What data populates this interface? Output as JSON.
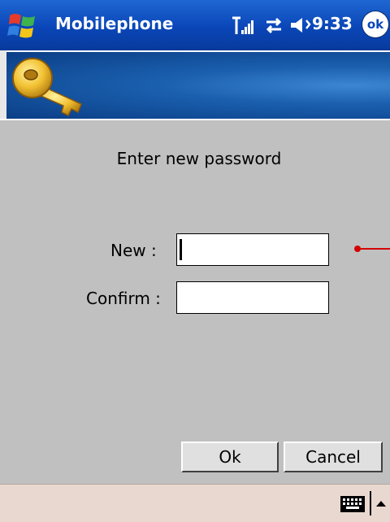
{
  "titlebar": {
    "title": "Mobilephone",
    "clock": "9:33",
    "ok_label": "ok"
  },
  "content": {
    "prompt": "Enter new password",
    "new_label": "New :",
    "confirm_label": "Confirm :",
    "new_value": "",
    "confirm_value": ""
  },
  "buttons": {
    "ok": "Ok",
    "cancel": "Cancel"
  },
  "colors": {
    "titlebar": "#0a46b8",
    "body": "#c0c0c0",
    "banner": "#1a5fae",
    "bottombar": "#e8d8d0",
    "marker": "#d40000"
  },
  "icons": {
    "start": "windows-flag-icon",
    "signal": "signal-strength-icon",
    "connectivity": "sync-arrows-icon",
    "volume": "speaker-icon",
    "banner": "key-icon",
    "keyboard": "keyboard-icon",
    "sip": "up-arrow-icon"
  }
}
